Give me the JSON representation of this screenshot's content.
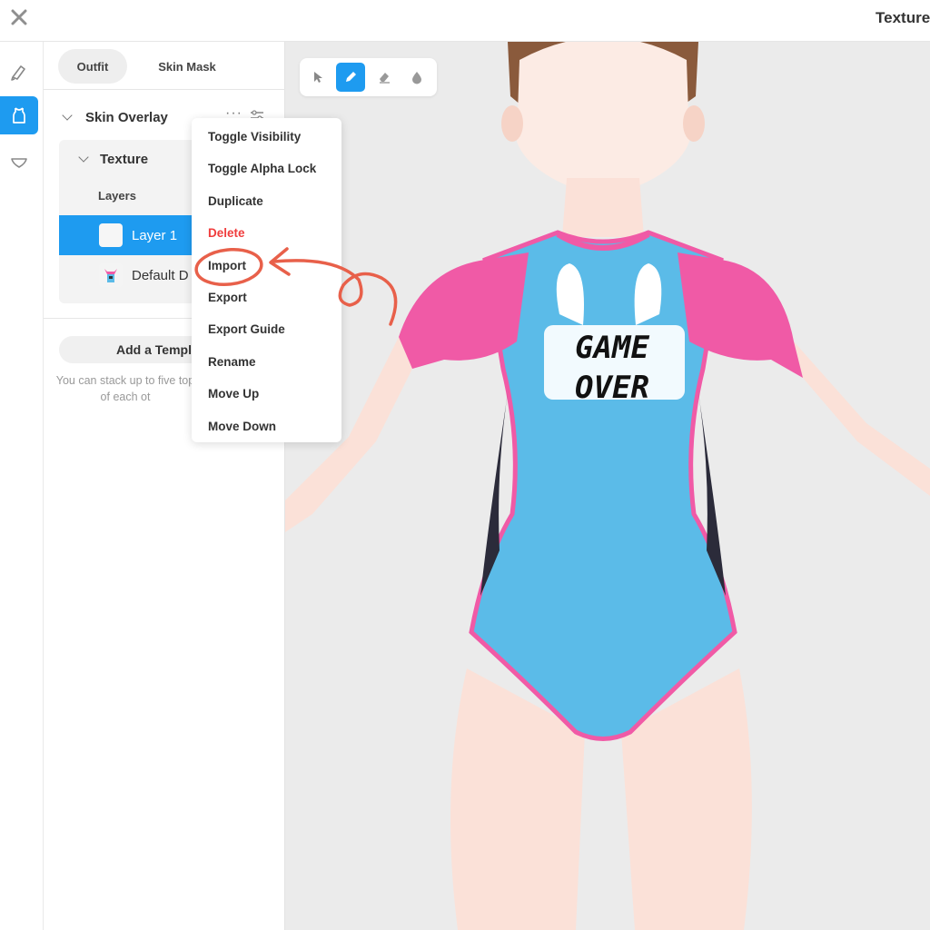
{
  "window": {
    "title": "Texture",
    "close_icon": "close-icon"
  },
  "rail": {
    "items": [
      {
        "name": "brush-icon",
        "active": false
      },
      {
        "name": "outfit-icon",
        "active": true
      },
      {
        "name": "accessory-icon",
        "active": false
      }
    ]
  },
  "panel": {
    "tabs": [
      {
        "label": "Outfit",
        "active": true
      },
      {
        "label": "Skin Mask",
        "active": false
      }
    ],
    "section_title": "Skin Overlay",
    "texture_title": "Texture",
    "layers_heading": "Layers",
    "layers": [
      {
        "name": "Layer 1",
        "selected": true
      },
      {
        "name": "Default D",
        "selected": false
      }
    ],
    "add_template_label": "Add a Templ",
    "hint_text": "You can stack up to five top of each ot"
  },
  "toolbar": {
    "tools": [
      {
        "name": "select-tool",
        "active": false
      },
      {
        "name": "pen-tool",
        "active": true
      },
      {
        "name": "eraser-tool",
        "active": false
      },
      {
        "name": "fill-tool",
        "active": false
      }
    ]
  },
  "context_menu": {
    "items": [
      "Toggle Visibility",
      "Toggle Alpha Lock",
      "Duplicate",
      "Delete",
      "Import",
      "Export",
      "Export Guide",
      "Rename",
      "Move Up",
      "Move Down"
    ],
    "danger_item": "Delete",
    "highlighted_item": "Import"
  },
  "model": {
    "shirt_text_line1": "GAME",
    "shirt_text_line2": "OVER"
  },
  "colors": {
    "accent": "#1e9bf0",
    "danger": "#f03c3c",
    "annotation": "#e8604a",
    "suit_blue": "#5bbbe8",
    "suit_pink": "#f05aa6",
    "skin": "#fbe1d8"
  }
}
